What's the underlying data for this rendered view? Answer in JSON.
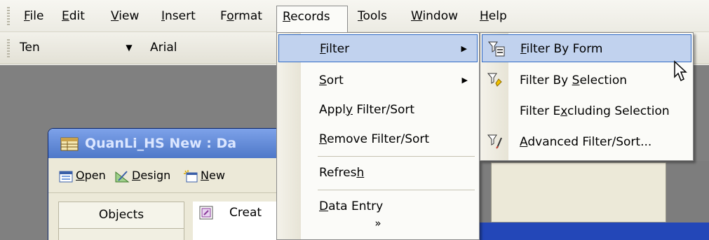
{
  "menubar": {
    "items": [
      {
        "label": "File",
        "accel": "F",
        "rest": "ile"
      },
      {
        "label": "Edit",
        "accel": "E",
        "rest": "dit"
      },
      {
        "label": "View",
        "accel": "V",
        "rest": "iew"
      },
      {
        "label": "Insert",
        "accel": "I",
        "rest": "nsert"
      },
      {
        "label": "Format",
        "pre": "F",
        "accel": "o",
        "rest": "rmat"
      },
      {
        "label": "Records",
        "accel": "R",
        "rest": "ecords"
      },
      {
        "label": "Tools",
        "accel": "T",
        "rest": "ools"
      },
      {
        "label": "Window",
        "accel": "W",
        "rest": "indow"
      },
      {
        "label": "Help",
        "accel": "H",
        "rest": "elp"
      }
    ]
  },
  "toolbar": {
    "object_combo_value": "Ten",
    "font_combo_value": "Arial"
  },
  "records_menu": {
    "items": [
      {
        "label": "Filter",
        "accel": "F",
        "rest": "ilter",
        "has_submenu": true,
        "highlighted": true
      },
      {
        "label": "Sort",
        "accel": "S",
        "rest": "ort",
        "has_submenu": true
      },
      {
        "label": "Apply Filter/Sort",
        "pre": "Appl",
        "accel": "y",
        "rest": " Filter/Sort"
      },
      {
        "label": "Remove Filter/Sort",
        "accel": "R",
        "rest": "emove Filter/Sort"
      },
      {
        "label": "Refresh",
        "pre": "Refres",
        "accel": "h",
        "rest": ""
      },
      {
        "label": "Data Entry",
        "accel": "D",
        "rest": "ata Entry"
      }
    ],
    "more_glyph": "»"
  },
  "filter_submenu": {
    "items": [
      {
        "label": "Filter By Form",
        "accel": "F",
        "rest": "ilter By Form",
        "icon": "filter-by-form-icon",
        "highlighted": true
      },
      {
        "label": "Filter By Selection",
        "pre": "Filter By ",
        "accel": "S",
        "rest": "election",
        "icon": "filter-by-selection-icon"
      },
      {
        "label": "Filter Excluding Selection",
        "pre": "Filter E",
        "accel": "x",
        "rest": "cluding Selection",
        "icon": ""
      },
      {
        "label": "Advanced Filter/Sort...",
        "accel": "A",
        "rest": "dvanced Filter/Sort...",
        "icon": "advanced-filter-icon"
      }
    ]
  },
  "db_window": {
    "title": "QuanLi_HS New : Da",
    "toolbar": {
      "open": "Open",
      "open_accel": "O",
      "open_rest": "pen",
      "design": "Design",
      "design_accel": "D",
      "design_rest": "esign",
      "new": "New",
      "new_accel": "N",
      "new_rest": "ew"
    },
    "objects_header": "Objects",
    "list_first_item": "Creat"
  },
  "colors": {
    "highlight_bg": "#c1d2ee",
    "highlight_border": "#316ac5",
    "title_bar": "#4e78c8"
  }
}
